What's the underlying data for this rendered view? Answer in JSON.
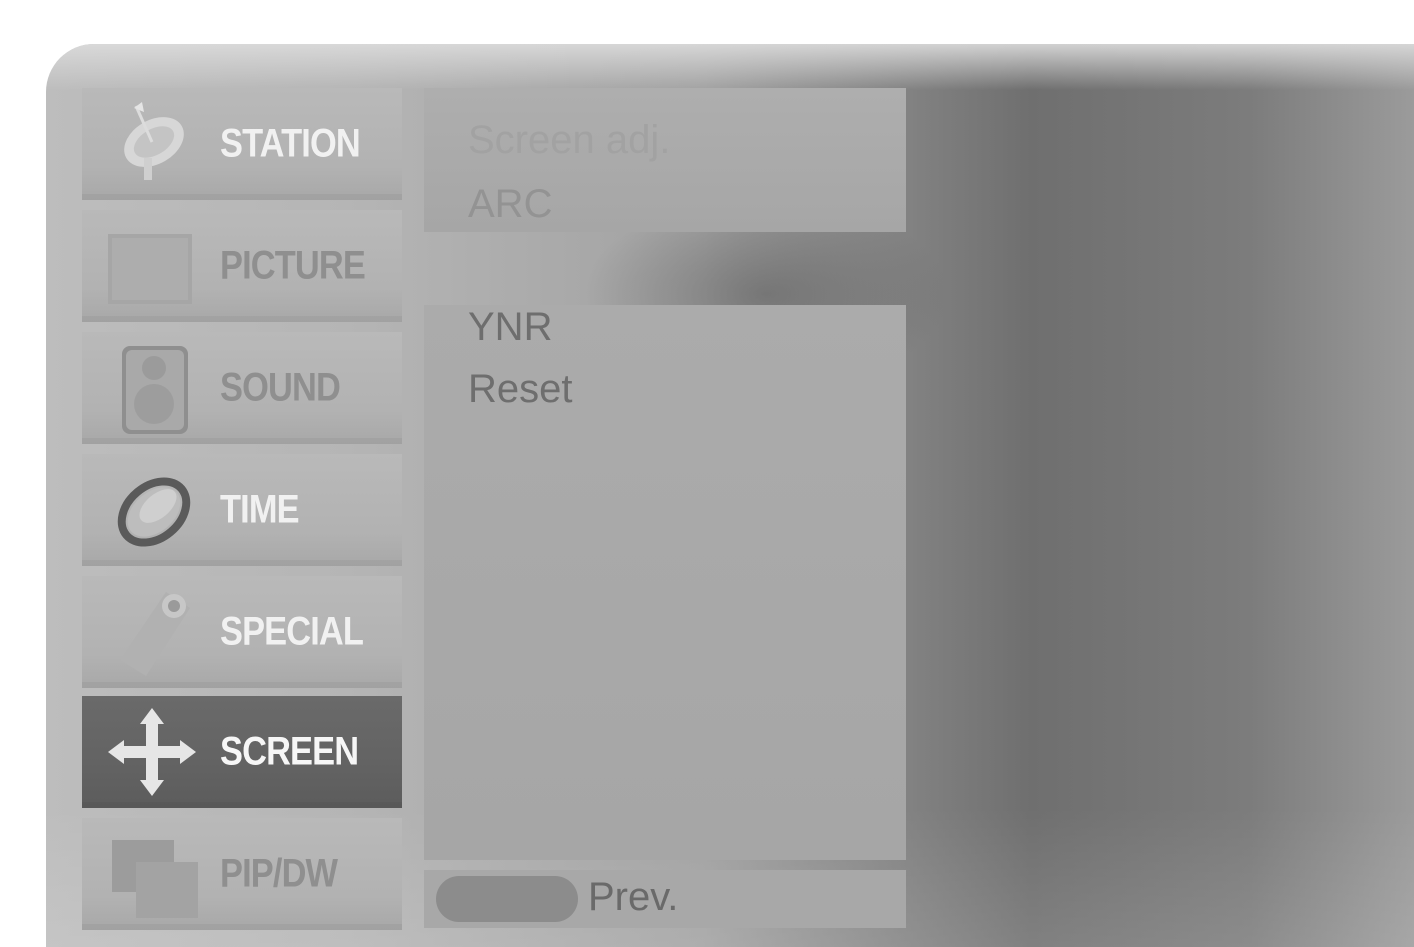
{
  "menu": {
    "items": [
      {
        "label": "STATION",
        "icon": "satellite-dish-icon"
      },
      {
        "label": "PICTURE",
        "icon": "tv-screen-icon"
      },
      {
        "label": "SOUND",
        "icon": "speaker-icon"
      },
      {
        "label": "TIME",
        "icon": "clock-ring-icon"
      },
      {
        "label": "SPECIAL",
        "icon": "tag-icon"
      },
      {
        "label": "SCREEN",
        "icon": "move-arrows-icon"
      },
      {
        "label": "PIP/DW",
        "icon": "pip-window-icon"
      }
    ],
    "selected": "SCREEN"
  },
  "screen_menu": {
    "top_options": [
      "Screen adj.",
      "ARC"
    ],
    "main_options": [
      "YNR",
      "Reset"
    ]
  },
  "footer": {
    "prev_label": "Prev."
  }
}
